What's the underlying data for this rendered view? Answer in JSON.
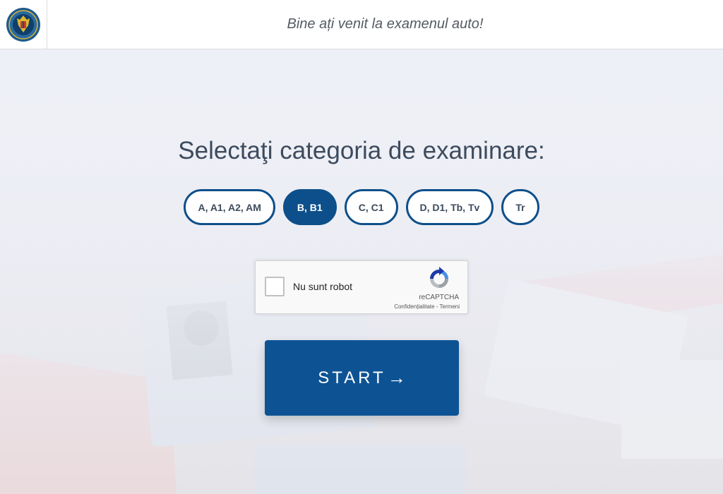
{
  "header": {
    "welcome_text": "Bine ați venit la examenul auto!"
  },
  "main": {
    "title": "Selectaţi categoria de examinare:",
    "categories": [
      {
        "label": "A, A1, A2, AM",
        "selected": false
      },
      {
        "label": "B, B1",
        "selected": true
      },
      {
        "label": "C, C1",
        "selected": false
      },
      {
        "label": "D, D1, Tb, Tv",
        "selected": false
      },
      {
        "label": "Tr",
        "selected": false
      }
    ],
    "captcha": {
      "label": "Nu sunt robot",
      "brand": "reCAPTCHA",
      "terms": "Confidențialitate - Termeni"
    },
    "start_label": "START",
    "start_arrow_icon": "arrow-right-icon"
  },
  "colors": {
    "primary": "#0d4f8a",
    "button": "#0d5394",
    "title_text": "#3d4b5e",
    "header_text": "#555a63"
  }
}
